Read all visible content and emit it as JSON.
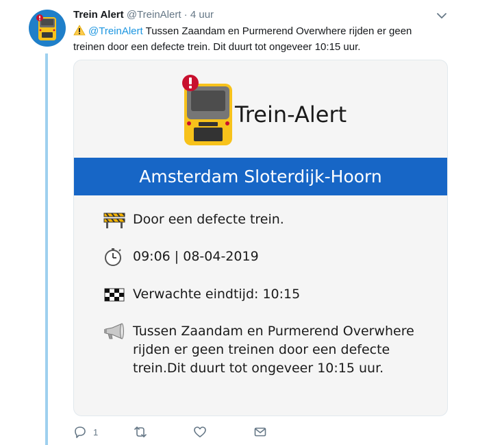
{
  "tweet": {
    "display_name": "Trein Alert",
    "handle": "@TreinAlert",
    "separator": "·",
    "time": "4 uur",
    "mention": "@TreinAlert",
    "text": " Tussen Zaandam en Purmerend Overwhere rijden er geen treinen door een defecte trein. Dit duurt tot ongeveer 10:15 uur."
  },
  "card": {
    "brand": "Trein-Alert",
    "route": "Amsterdam Sloterdijk-Hoorn",
    "rows": [
      {
        "icon": "roadblock-icon",
        "text": "Door een defecte trein."
      },
      {
        "icon": "stopwatch-icon",
        "text": "09:06 | 08-04-2019"
      },
      {
        "icon": "checkered-flag-icon",
        "text": "Verwachte eindtijd: 10:15"
      },
      {
        "icon": "megaphone-icon",
        "text": "Tussen Zaandam en Purmerend Overwhere rijden er geen treinen door een defecte trein.Dit duurt tot ongeveer 10:15 uur."
      }
    ]
  },
  "actions": {
    "reply_count": "1"
  },
  "colors": {
    "accent": "#1b95e0",
    "route_bar": "#1766c6",
    "train_yellow": "#f7c21b",
    "alert_red": "#c8102e"
  }
}
